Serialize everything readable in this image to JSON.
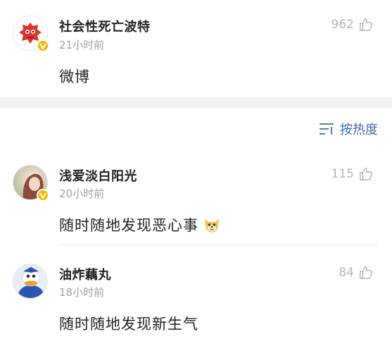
{
  "top_comment": {
    "username": "社会性死亡波特",
    "time": "21小时前",
    "content": "微博",
    "likes": "962"
  },
  "sort": {
    "label": "按热度",
    "icon": "sort-icon"
  },
  "comments": [
    {
      "username": "浅爱淡白阳光",
      "time": "20小时前",
      "content": "随时随地发现恶心事",
      "emoji": "doge-emoji",
      "likes": "115"
    },
    {
      "username": "油炸藕丸",
      "time": "18小时前",
      "content": "随时随地发现新生气",
      "likes": "84"
    }
  ],
  "colors": {
    "link_blue": "#3d6fa8",
    "verified_badge": "#f5b800",
    "muted_gray": "#a0a0a0"
  }
}
